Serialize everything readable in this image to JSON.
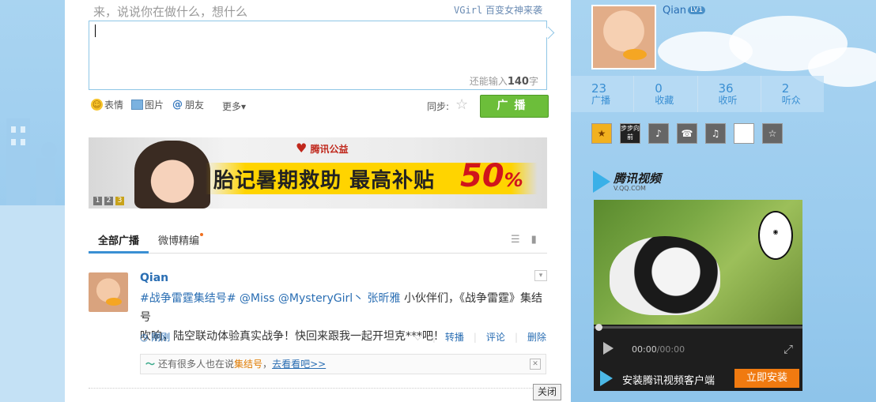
{
  "composer": {
    "hint": "来，说说你在做什么，想什么",
    "topic_en": "VGirl",
    "topic_cn": " 百变女神来袭",
    "count_prefix": "还能输入",
    "count_value": "140",
    "count_suffix": "字",
    "tools": {
      "emoji": "表情",
      "image": "图片",
      "friends": "朋友",
      "more": "更多▾"
    },
    "sync_label": "同步:",
    "broadcast_button": "广播"
  },
  "banner": {
    "org": "腾讯公益",
    "slogan": "胎记暑期救助 最高补贴",
    "percent": "50",
    "percent_sign": "%",
    "pages": [
      "1",
      "2",
      "3"
    ]
  },
  "feed": {
    "tabs": [
      "全部广播",
      "微博精编"
    ],
    "post": {
      "user": "Qian",
      "hashtag": "#战争雷霆集结号#",
      "mentions": " @Miss @MysteryGirl丶 张昕雅",
      "text_line1_rest": " 小伙伴们，《战争雷霆》集结号",
      "text_line2": "吹响，陆空联动体验真实战争！快回来跟我一起开坦克***吧！",
      "time": "刚刚",
      "actions": [
        "转播",
        "评论",
        "删除"
      ]
    },
    "tip": {
      "prefix": "还有很多人也在说",
      "topic": "集结号",
      "sep": "，",
      "link": "去看看吧>>"
    },
    "close_button": "关闭"
  },
  "profile": {
    "name": "Qian",
    "level": "LV1",
    "stats": [
      {
        "value": "23",
        "label": "广播"
      },
      {
        "value": "0",
        "label": "收藏"
      },
      {
        "value": "36",
        "label": "收听"
      },
      {
        "value": "2",
        "label": "听众"
      }
    ],
    "app_second_label": "步步向前"
  },
  "video": {
    "brand": "腾讯视频",
    "domain": "V.QQ.COM",
    "time_current": "00:00",
    "time_total": "/00:00",
    "install_text": "安装腾讯视频客户端",
    "install_button": "立即安装",
    "progress": 0
  },
  "colors": {
    "accent_blue": "#3a8fd3",
    "link_blue": "#2a6eb3",
    "broadcast_green": "#6cbe3a",
    "install_orange": "#f07a10"
  }
}
